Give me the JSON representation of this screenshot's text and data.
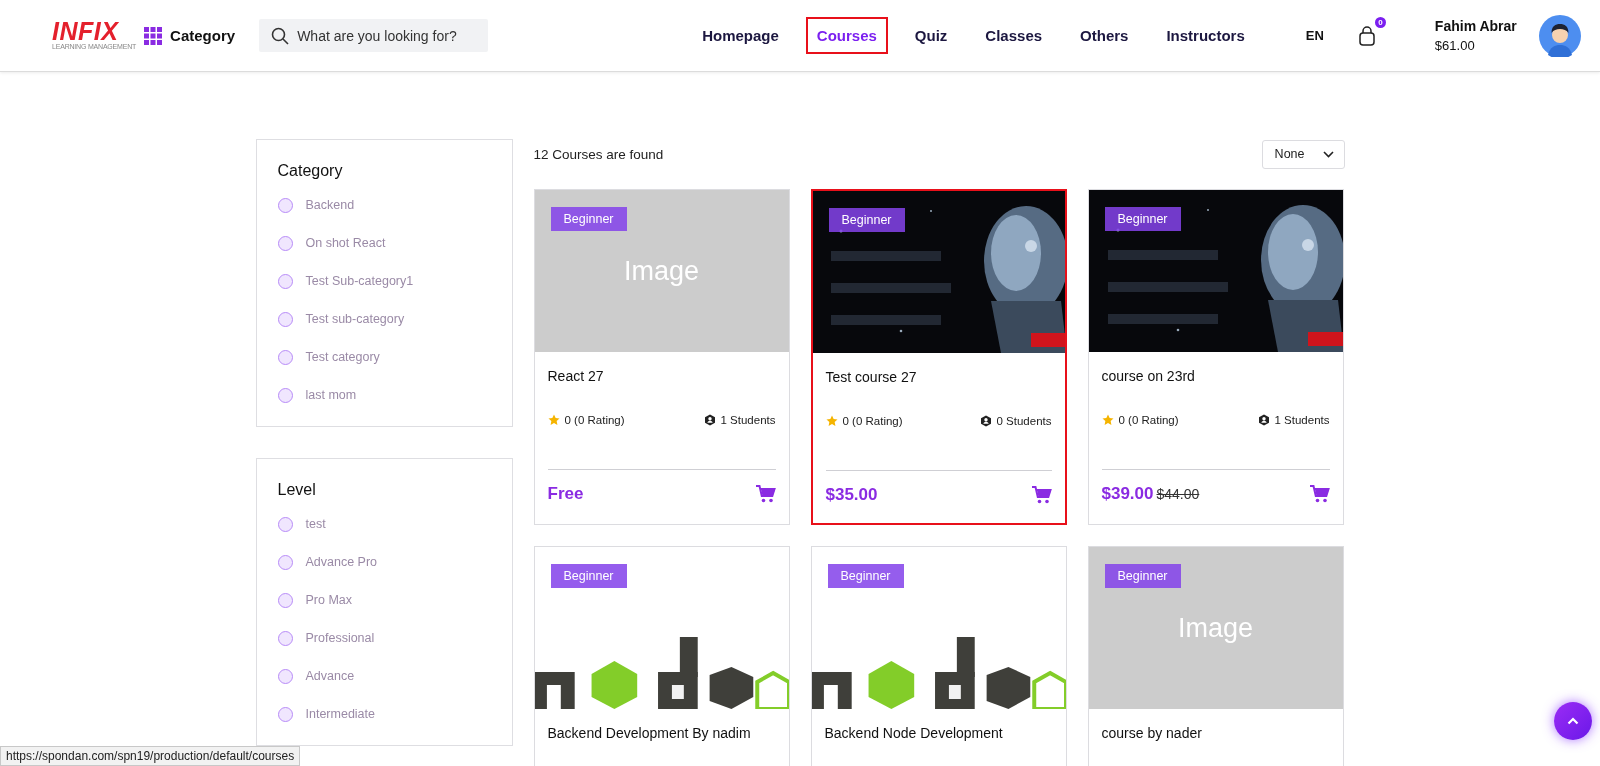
{
  "header": {
    "logo": {
      "text": "INFIX",
      "tagline": "LEARNING MANAGEMENT"
    },
    "category_button": "Category",
    "search": {
      "placeholder": "What are you looking for?"
    },
    "nav": [
      {
        "label": "Homepage",
        "selected": false,
        "highlighted": false
      },
      {
        "label": "Courses",
        "selected": true,
        "highlighted": true
      },
      {
        "label": "Quiz",
        "selected": false,
        "highlighted": false
      },
      {
        "label": "Classes",
        "selected": false,
        "highlighted": false
      },
      {
        "label": "Others",
        "selected": false,
        "highlighted": false
      },
      {
        "label": "Instructors",
        "selected": false,
        "highlighted": false
      }
    ],
    "language": "EN",
    "cart_count": "0",
    "user": {
      "name": "Fahim Abrar",
      "balance": "$61.00"
    }
  },
  "filters": [
    {
      "title": "Category",
      "options": [
        {
          "label": "Backend",
          "selected": false
        },
        {
          "label": "On shot React",
          "selected": false
        },
        {
          "label": "Test Sub-category1",
          "selected": false
        },
        {
          "label": "Test sub-category",
          "selected": false
        },
        {
          "label": "Test category",
          "selected": false
        },
        {
          "label": "last mom",
          "selected": false
        }
      ]
    },
    {
      "title": "Level",
      "options": [
        {
          "label": "test",
          "selected": false
        },
        {
          "label": "Advance Pro",
          "selected": false
        },
        {
          "label": "Pro Max",
          "selected": false
        },
        {
          "label": "Professional",
          "selected": false
        },
        {
          "label": "Advance",
          "selected": false
        },
        {
          "label": "Intermediate",
          "selected": false
        }
      ]
    }
  ],
  "results_count": "12 Courses are found",
  "sort": {
    "value": "None"
  },
  "courses": [
    {
      "level": "Beginner",
      "image": {
        "kind": "placeholder",
        "label": "Image"
      },
      "title": "React 27",
      "rating": "0 (0 Rating)",
      "students": "1 Students",
      "price": "Free",
      "highlighted": false
    },
    {
      "level": "Beginner",
      "image": {
        "kind": "dark-picture"
      },
      "title": "Test course 27",
      "rating": "0 (0 Rating)",
      "students": "0 Students",
      "price": "$35.00",
      "highlighted": true
    },
    {
      "level": "Beginner",
      "image": {
        "kind": "dark-picture"
      },
      "title": "course on 23rd",
      "rating": "0 (0 Rating)",
      "students": "1 Students",
      "price": "$39.00",
      "old_price": "$44.00",
      "highlighted": false
    },
    {
      "level": "Beginner",
      "image": {
        "kind": "light-picture"
      },
      "title": "Backend Development By nadim",
      "highlighted": false
    },
    {
      "level": "Beginner",
      "image": {
        "kind": "light-picture"
      },
      "title": "Backend Node Development",
      "highlighted": false
    },
    {
      "level": "Beginner",
      "image": {
        "kind": "placeholder",
        "label": "Image"
      },
      "title": "course by nader",
      "highlighted": false
    }
  ],
  "status_url": "https://spondan.com/spn19/production/default/courses"
}
